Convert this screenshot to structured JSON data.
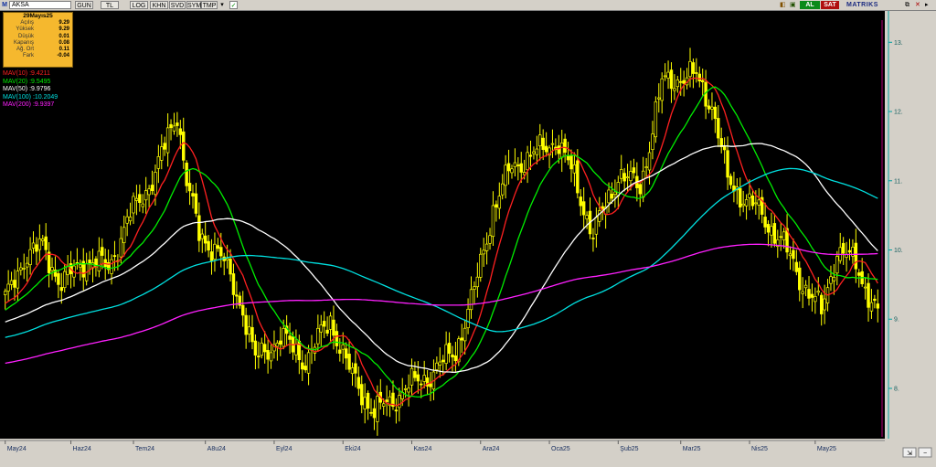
{
  "toolbar": {
    "menu_icon": "M",
    "symbol": "AKSA",
    "buttons": [
      "GUN",
      "TL",
      "LOG",
      "KHN",
      "SVD",
      "SYM",
      "TMP"
    ],
    "buy_label": "AL",
    "sell_label": "SAT",
    "brand": "MATRIKS"
  },
  "info_box": {
    "date": "29Mayıs25",
    "rows": [
      {
        "label": "Açılış",
        "value": "9.29"
      },
      {
        "label": "Yüksek",
        "value": "9.29"
      },
      {
        "label": "Düşük",
        "value": "0.01"
      },
      {
        "label": "Kapanış",
        "value": "0.08"
      },
      {
        "label": "Ağ. Ort",
        "value": "0.11"
      },
      {
        "label": "Fark",
        "value": "-0.04"
      }
    ]
  },
  "legend": [
    {
      "name": "MAV(10)",
      "value": ":9.4211",
      "color": "#ff2020"
    },
    {
      "name": "MAV(20)",
      "value": ":9.5495",
      "color": "#00ee00"
    },
    {
      "name": "MAV(50)",
      "value": ":9.9796",
      "color": "#ffffff"
    },
    {
      "name": "MAV(100)",
      "value": ":10.2049",
      "color": "#00e0e0"
    },
    {
      "name": "MAV(200)",
      "value": ":9.9397",
      "color": "#ff20ff"
    }
  ],
  "chart_data": {
    "type": "line",
    "candle_color": "#ffff00",
    "background": "#000000",
    "y_ticks": [
      "13.",
      "12.",
      "11.",
      "10.",
      "9.",
      "8."
    ],
    "y_tick_values": [
      13,
      12,
      11,
      10,
      9,
      8
    ],
    "ylim": [
      7.3,
      13.4
    ],
    "x_tick_labels": [
      "May24",
      "Haz24",
      "Tem24",
      "A8u24",
      "Eyl24",
      "Eki24",
      "Kas24",
      "Ara24",
      "Oca25",
      "Şub25",
      "Mar25",
      "Nis25",
      "May25"
    ],
    "x_tick_index": [
      0,
      21,
      41,
      64,
      86,
      108,
      130,
      152,
      174,
      196,
      216,
      238,
      259
    ],
    "n_bars": 280,
    "price_anchors": [
      [
        0,
        9.25
      ],
      [
        6,
        9.9
      ],
      [
        12,
        10.05
      ],
      [
        18,
        9.5
      ],
      [
        25,
        9.85
      ],
      [
        33,
        9.75
      ],
      [
        40,
        10.5
      ],
      [
        48,
        11.1
      ],
      [
        55,
        12.0
      ],
      [
        58,
        11.0
      ],
      [
        62,
        10.2
      ],
      [
        68,
        10.0
      ],
      [
        76,
        9.15
      ],
      [
        80,
        8.4
      ],
      [
        88,
        8.75
      ],
      [
        96,
        8.4
      ],
      [
        104,
        9.0
      ],
      [
        110,
        8.25
      ],
      [
        118,
        7.65
      ],
      [
        123,
        7.8
      ],
      [
        128,
        8.0
      ],
      [
        136,
        8.2
      ],
      [
        144,
        8.55
      ],
      [
        150,
        9.4
      ],
      [
        156,
        10.6
      ],
      [
        162,
        11.2
      ],
      [
        170,
        11.4
      ],
      [
        176,
        11.6
      ],
      [
        182,
        11.05
      ],
      [
        188,
        10.2
      ],
      [
        196,
        11.1
      ],
      [
        203,
        10.9
      ],
      [
        210,
        12.4
      ],
      [
        216,
        12.5
      ],
      [
        221,
        12.5
      ],
      [
        226,
        12.1
      ],
      [
        231,
        11.0
      ],
      [
        240,
        10.6
      ],
      [
        248,
        10.15
      ],
      [
        254,
        9.6
      ],
      [
        261,
        9.1
      ],
      [
        266,
        10.0
      ],
      [
        272,
        9.8
      ],
      [
        279,
        9.05
      ]
    ],
    "series": [
      {
        "name": "MAV(10)",
        "color": "#ff2020",
        "period": 10
      },
      {
        "name": "MAV(20)",
        "color": "#00ee00",
        "period": 20
      },
      {
        "name": "MAV(50)",
        "color": "#ffffff",
        "period": 50
      },
      {
        "name": "MAV(100)",
        "color": "#00e0e0",
        "period": 100
      },
      {
        "name": "MAV(200)",
        "color": "#ff20ff",
        "period": 200
      }
    ]
  }
}
